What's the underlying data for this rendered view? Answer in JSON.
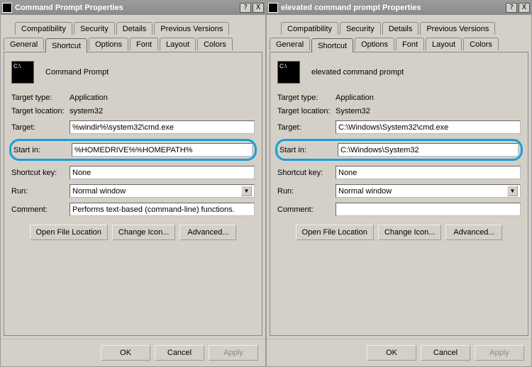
{
  "windows": [
    {
      "title": "Command Prompt Properties",
      "icon_name": "Command Prompt",
      "target_type": "Application",
      "target_location": "system32",
      "target": "%windir%\\system32\\cmd.exe",
      "start_in": "%HOMEDRIVE%%HOMEPATH%",
      "shortcut_key": "None",
      "run": "Normal window",
      "comment": "Performs text-based (command-line) functions."
    },
    {
      "title": "elevated command prompt Properties",
      "icon_name": "elevated command prompt",
      "target_type": "Application",
      "target_location": "System32",
      "target": "C:\\Windows\\System32\\cmd.exe",
      "start_in": "C:\\Windows\\System32",
      "shortcut_key": "None",
      "run": "Normal window",
      "comment": ""
    }
  ],
  "tabs": {
    "upper": [
      "Compatibility",
      "Security",
      "Details",
      "Previous Versions"
    ],
    "lower": [
      "General",
      "Shortcut",
      "Options",
      "Font",
      "Layout",
      "Colors"
    ]
  },
  "labels": {
    "target_type": "Target type:",
    "target_location": "Target location:",
    "target": "Target:",
    "start_in": "Start in:",
    "shortcut_key": "Shortcut key:",
    "run": "Run:",
    "comment": "Comment:",
    "open_file_location": "Open File Location",
    "change_icon": "Change Icon...",
    "advanced": "Advanced...",
    "ok": "OK",
    "cancel": "Cancel",
    "apply": "Apply"
  },
  "winctl": {
    "help": "?",
    "close": "X"
  }
}
